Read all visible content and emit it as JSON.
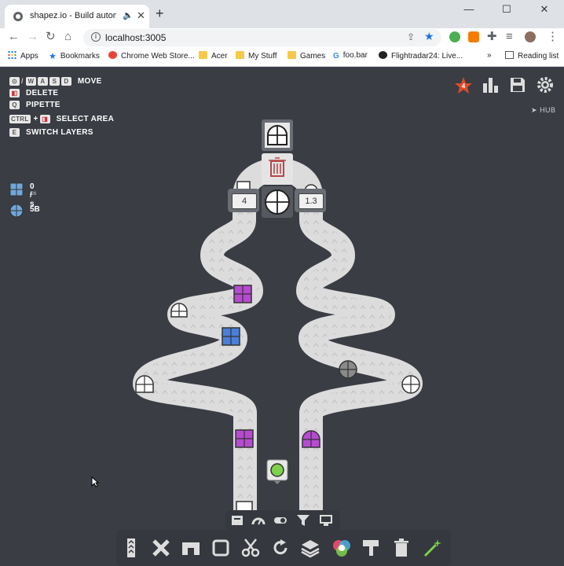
{
  "browser": {
    "tab_title": "shapez.io - Build automated",
    "url": "localhost:3005",
    "bookmarks": [
      {
        "label": "Apps",
        "icon": "apps-icon"
      },
      {
        "label": "Bookmarks",
        "icon": "star-icon"
      },
      {
        "label": "Chrome Web Store...",
        "icon": "webstore-icon"
      },
      {
        "label": "Acer",
        "icon": "folder-icon"
      },
      {
        "label": "My Stuff",
        "icon": "folder-icon"
      },
      {
        "label": "Games",
        "icon": "folder-icon"
      },
      {
        "label": "foo.bar",
        "icon": "google-icon"
      },
      {
        "label": "Flightradar24: Live...",
        "icon": "flightradar-icon"
      }
    ],
    "overflow": "»",
    "reading_list": "Reading list"
  },
  "game": {
    "keybindings": [
      {
        "keys": [
          "W",
          "A",
          "S",
          "D"
        ],
        "label": "MOVE",
        "mouse": true
      },
      {
        "keys": [],
        "label": "DELETE",
        "mouse": true
      },
      {
        "keys": [
          "Q"
        ],
        "label": "PIPETTE",
        "mouse": false
      },
      {
        "keys": [
          "CTRL",
          "+"
        ],
        "label": "SELECT AREA",
        "mouse": true
      },
      {
        "keys": [
          "E"
        ],
        "label": "SWITCH LAYERS",
        "mouse": false
      }
    ],
    "stats": [
      {
        "value": "0 / s",
        "sub": "/26"
      },
      {
        "value": "5B",
        "sub": ""
      }
    ],
    "hub_label": "HUB",
    "level_badge": "4",
    "counters": [
      "4",
      "1.3"
    ],
    "colors": {
      "background": "#3a3d44",
      "belt": "#dcdcdc",
      "purple": "#b64ad1",
      "blue": "#4a7fd8",
      "green": "#7ed14a",
      "accent": "#e04a2a"
    },
    "toolbar_icons": [
      "belt-icon",
      "balancer-icon",
      "tunnel-icon",
      "rotator-frame-icon",
      "cutter-icon",
      "rotate-icon",
      "stacker-icon",
      "mixer-icon",
      "painter-icon",
      "trash-icon",
      "wand-icon"
    ],
    "sub_toolbar_icons": [
      "storage-icon",
      "speedometer-icon",
      "toggle-icon",
      "filter-icon",
      "display-icon"
    ]
  }
}
